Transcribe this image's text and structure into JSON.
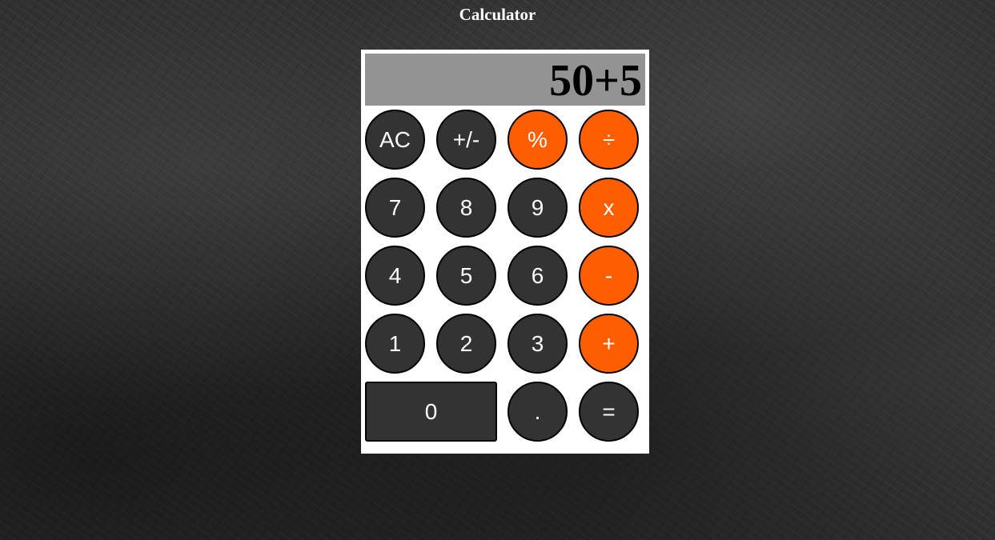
{
  "page": {
    "title": "Calculator"
  },
  "display": {
    "value": "50+5"
  },
  "buttons": {
    "ac": "AC",
    "sign": "+/-",
    "percent": "%",
    "divide": "÷",
    "seven": "7",
    "eight": "8",
    "nine": "9",
    "multiply": "x",
    "four": "4",
    "five": "5",
    "six": "6",
    "subtract": "-",
    "one": "1",
    "two": "2",
    "three": "3",
    "add": "+",
    "zero": "0",
    "decimal": ".",
    "equals": "="
  },
  "colors": {
    "operator": "#ff5e00",
    "digit": "#333333",
    "display_bg": "#939393",
    "panel_bg": "#ffffff"
  }
}
